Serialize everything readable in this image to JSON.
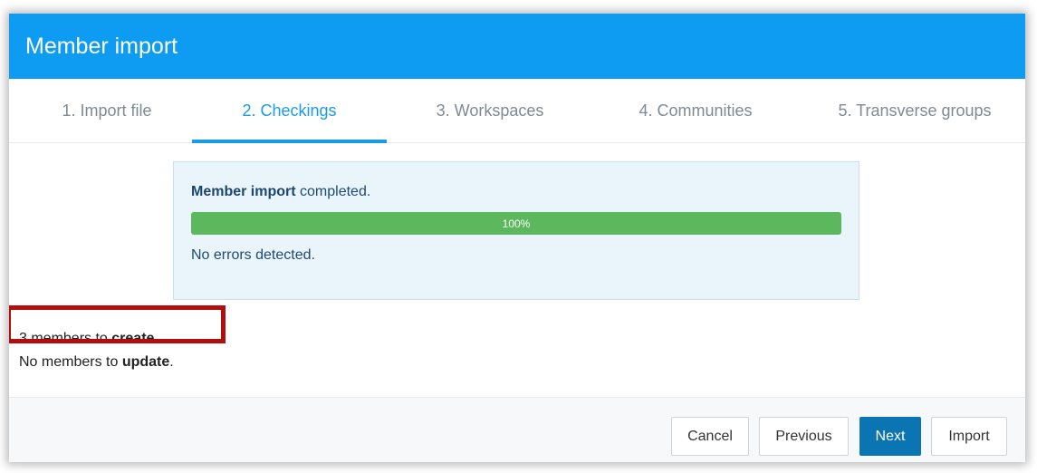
{
  "dialog": {
    "title": "Member import"
  },
  "tabs": [
    {
      "label": "1. Import file",
      "active": false
    },
    {
      "label": "2. Checkings",
      "active": true
    },
    {
      "label": "3. Workspaces",
      "active": false
    },
    {
      "label": "4. Communities",
      "active": false
    },
    {
      "label": "5. Transverse groups",
      "active": false
    }
  ],
  "alert": {
    "strong": "Member import",
    "rest": " completed.",
    "progress_percent": 100,
    "progress_label": "100%",
    "status": "No errors detected."
  },
  "summary": {
    "create_prefix": "3 members to ",
    "create_strong": "create",
    "create_suffix": ".",
    "update_prefix": "No members to ",
    "update_strong": "update",
    "update_suffix": "."
  },
  "footer": {
    "cancel_label": "Cancel",
    "previous_label": "Previous",
    "next_label": "Next",
    "import_label": "Import"
  },
  "colors": {
    "header": "#0e9bf2",
    "active_tab": "#1a9be6",
    "progress_fill": "#5cb85c",
    "primary_button": "#0b75b3",
    "highlight_box": "#b30e0e"
  }
}
